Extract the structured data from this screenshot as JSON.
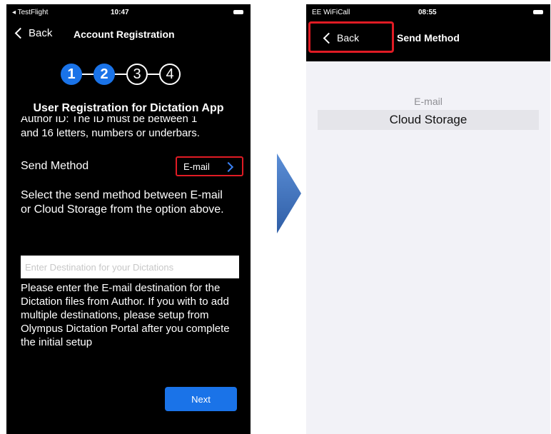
{
  "left_screen": {
    "status": {
      "carrier": "◂ TestFlight",
      "time": "10:47"
    },
    "nav": {
      "back_label": "Back",
      "title": "Account Registration"
    },
    "steps": [
      "1",
      "2",
      "3",
      "4"
    ],
    "active_steps": 2,
    "title": "User Registration for Dictation App",
    "author_line_clipped": "Author ID: The ID must be between 1",
    "author_line": "and 16 letters, numbers or underbars.",
    "send_method": {
      "label": "Send Method",
      "value": "E-mail"
    },
    "send_description": "Select the send method between E-mail or Cloud Storage from the option above.",
    "destination_placeholder": "Enter Destination for your Dictations",
    "destination_description": "Please enter the E-mail destination for the Dictation files from Author. If you with to add multiple destinations, please setup from Olympus Dictation Portal after you complete the initial setup",
    "next_label": "Next"
  },
  "right_screen": {
    "status": {
      "carrier": "EE WiFiCall",
      "time": "08:55"
    },
    "nav": {
      "back_label": "Back",
      "title": "Send Method"
    },
    "options": [
      "E-mail",
      "Cloud Storage"
    ],
    "selected_option": "Cloud Storage"
  },
  "colors": {
    "accent": "#1a73e8",
    "highlight": "#e01b24",
    "arrow": "#3f6fb5"
  }
}
